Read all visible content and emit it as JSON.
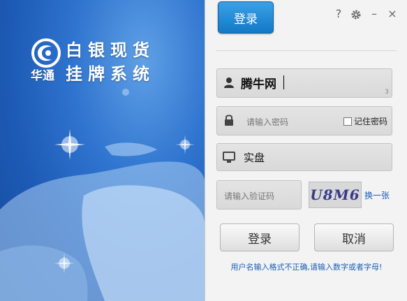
{
  "brand": {
    "line1": "白银现货",
    "line2": "挂牌系统",
    "company": "华通"
  },
  "tabs": {
    "login": "登录"
  },
  "window_controls": {
    "help": "?",
    "settings_icon": "gear-icon",
    "minimize": "–",
    "close": "×"
  },
  "form": {
    "username": "腾牛网",
    "username_length": "3",
    "password_placeholder": "请输入密码",
    "remember_password": "记住密码",
    "account_type": "实盘",
    "captcha_placeholder": "请输入验证码",
    "captcha_text": "U8M6",
    "refresh_captcha": "换一张"
  },
  "buttons": {
    "login": "登录",
    "cancel": "取消"
  },
  "status_message": "用户名输入格式不正确,请输入数字或者字母!",
  "colors": {
    "accent": "#1479c6",
    "link": "#1a5fb4",
    "panel_bg": "#f3f3f3"
  }
}
